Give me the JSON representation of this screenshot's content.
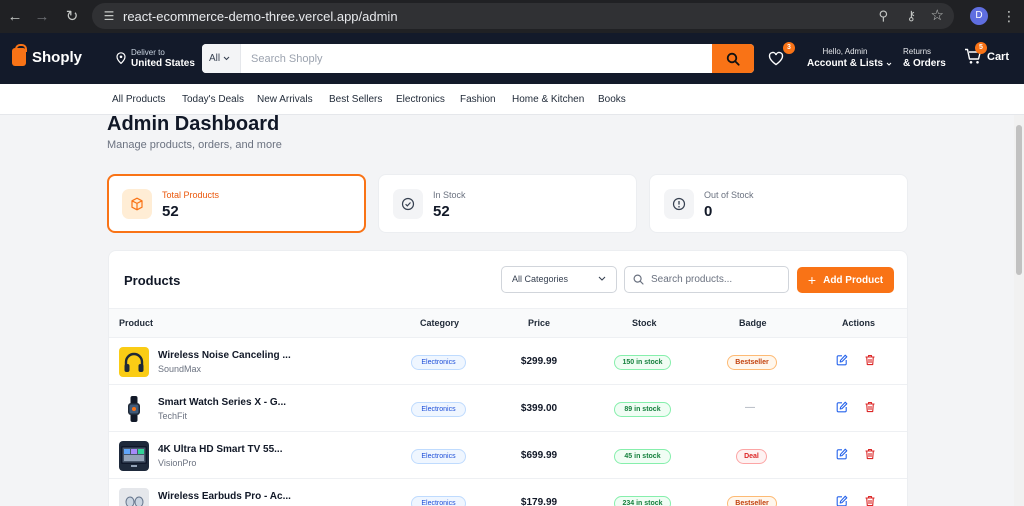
{
  "browser": {
    "url": "react-ecommerce-demo-three.vercel.app/admin",
    "profile_initial": "D"
  },
  "header": {
    "logo": "Shoply",
    "deliver_line1": "Deliver to",
    "deliver_line2": "United States",
    "search_category": "All",
    "search_placeholder": "Search Shoply",
    "wishlist_count": "3",
    "account_line1": "Hello, Admin",
    "account_line2": "Account & Lists",
    "returns_line1": "Returns",
    "returns_line2": "& Orders",
    "cart_count": "5",
    "cart_label": "Cart",
    "brand_color": "#f97316",
    "header_bg": "#131a2a"
  },
  "nav": {
    "items": [
      "All Products",
      "Today's Deals",
      "New Arrivals",
      "Best Sellers",
      "Electronics",
      "Fashion",
      "Home & Kitchen",
      "Books"
    ]
  },
  "page": {
    "title": "Admin Dashboard",
    "subtitle": "Manage products, orders, and more"
  },
  "stats": [
    {
      "label": "Total Products",
      "value": "52",
      "icon": "box-icon"
    },
    {
      "label": "In Stock",
      "value": "52",
      "icon": "check-circle-icon"
    },
    {
      "label": "Out of Stock",
      "value": "0",
      "icon": "alert-circle-icon"
    }
  ],
  "products_panel": {
    "title": "Products",
    "category_filter": "All Categories",
    "search_placeholder": "Search products...",
    "add_label": "Add Product",
    "columns": [
      "Product",
      "Category",
      "Price",
      "Stock",
      "Badge",
      "Actions"
    ],
    "rows": [
      {
        "name": "Wireless Noise Canceling ...",
        "brand": "SoundMax",
        "category": "Electronics",
        "price": "$299.99",
        "stock": "150 in stock",
        "badge": "Bestseller",
        "thumb": "headphones"
      },
      {
        "name": "Smart Watch Series X - G...",
        "brand": "TechFit",
        "category": "Electronics",
        "price": "$399.00",
        "stock": "89 in stock",
        "badge": "—",
        "thumb": "watch"
      },
      {
        "name": "4K Ultra HD Smart TV 55...",
        "brand": "VisionPro",
        "category": "Electronics",
        "price": "$699.99",
        "stock": "45 in stock",
        "badge": "Deal",
        "thumb": "tv"
      },
      {
        "name": "Wireless Earbuds Pro - Ac...",
        "brand": "",
        "category": "Electronics",
        "price": "$179.99",
        "stock": "234 in stock",
        "badge": "Bestseller",
        "thumb": "earbuds"
      }
    ]
  }
}
